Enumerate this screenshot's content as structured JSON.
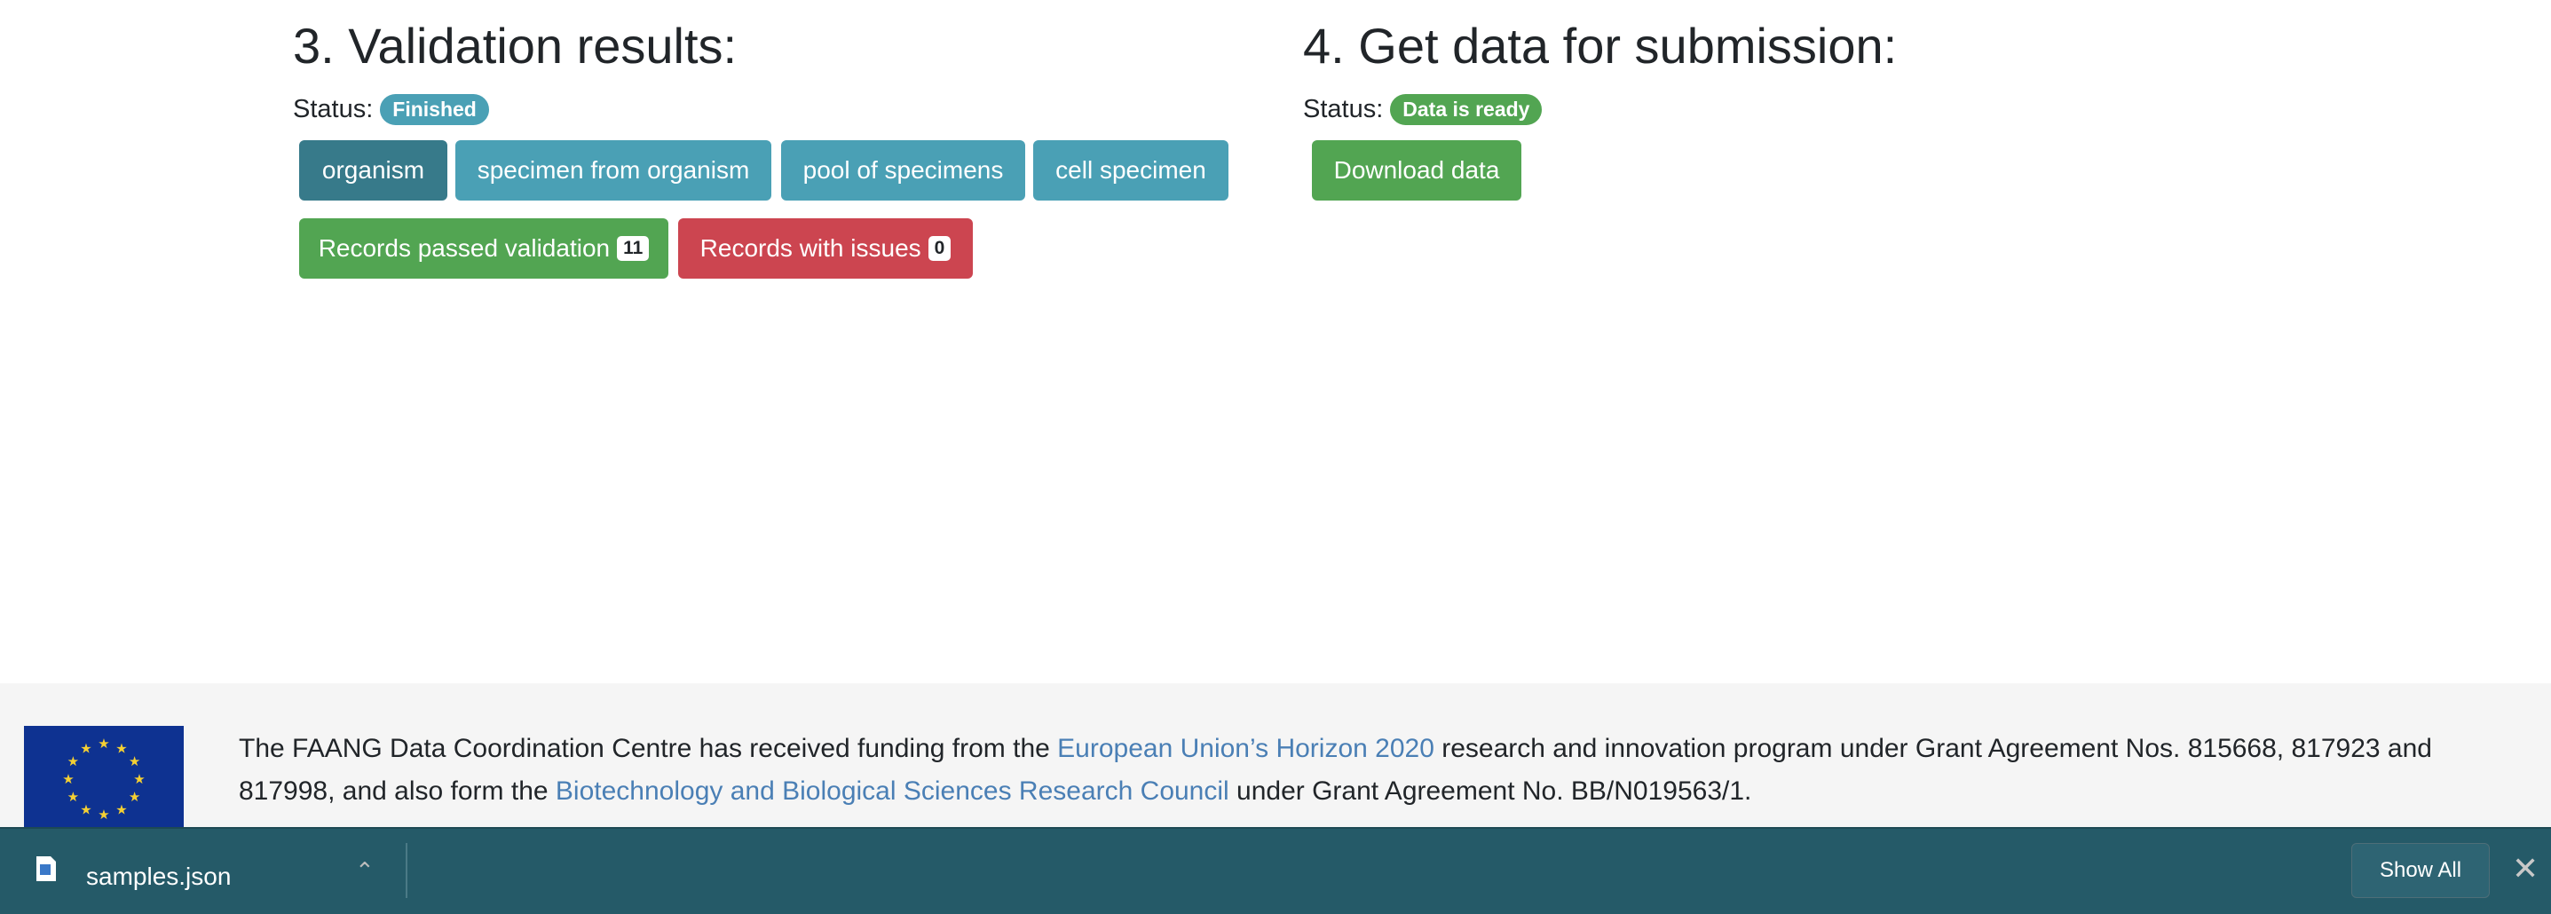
{
  "validation": {
    "title": "3. Validation results:",
    "status_label": "Status:",
    "status": "Finished",
    "tabs": [
      "organism",
      "specimen from organism",
      "pool of specimens",
      "cell specimen"
    ],
    "passed_label": "Records passed validation",
    "passed_count": "11",
    "issues_label": "Records with issues",
    "issues_count": "0"
  },
  "submission": {
    "title": "4. Get data for submission:",
    "status_label": "Status:",
    "status": "Data is ready",
    "download_label": "Download data"
  },
  "footer": {
    "t1": "The FAANG Data Coordination Centre has received funding from the ",
    "link1": "European Union’s Horizon 2020",
    "t2": " research and innovation program under Grant Agreement Nos. 815668, 817923 and 817998, and also form the ",
    "link2": "Biotechnology and Biological Sciences Research Council",
    "t3": " under Grant Agreement No. BB/N019563/1."
  },
  "downloads": {
    "file": "samples.json",
    "show_all": "Show All"
  },
  "colors": {
    "info": "#4aa0b5",
    "active": "#377a8a",
    "success": "#52a552",
    "danger": "#cc4550",
    "bar": "#255a68"
  }
}
